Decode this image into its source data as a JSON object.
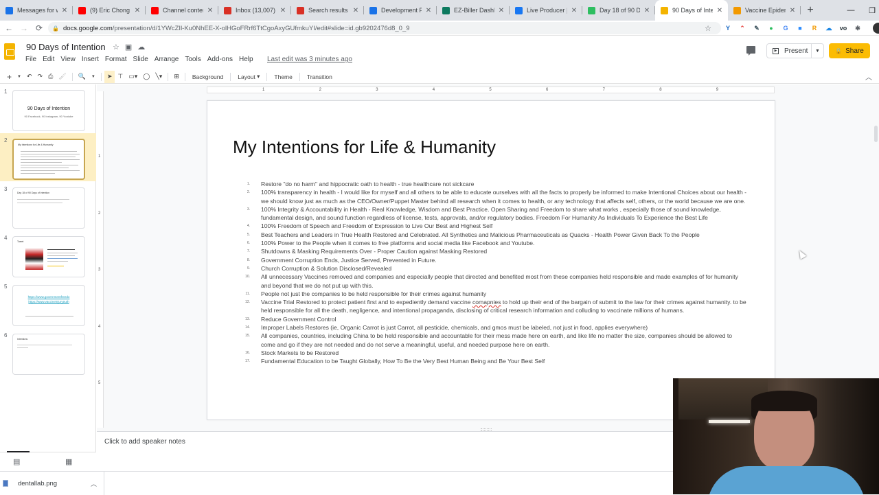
{
  "browser": {
    "tabs": [
      {
        "label": "Messages for w",
        "icon": "messenger-icon",
        "color": "#1a73e8",
        "active": false
      },
      {
        "label": "(9) Eric Chong -",
        "icon": "youtube-icon",
        "color": "#ff0000",
        "active": false
      },
      {
        "label": "Channel conten",
        "icon": "youtube-icon",
        "color": "#ff0000",
        "active": false
      },
      {
        "label": "Inbox (13,007) -",
        "icon": "gmail-icon",
        "color": "#d93025",
        "active": false
      },
      {
        "label": "Search results -",
        "icon": "gmail-icon",
        "color": "#d93025",
        "active": false
      },
      {
        "label": "Development P",
        "icon": "app-icon",
        "color": "#1a73e8",
        "active": false
      },
      {
        "label": "EZ-Biller Dashbo",
        "icon": "ez-icon",
        "color": "#0d7a5f",
        "active": false
      },
      {
        "label": "Live Producer |",
        "icon": "facebook-icon",
        "color": "#1877f2",
        "active": false
      },
      {
        "label": "Day 18 of 90 Da",
        "icon": "evernote-icon",
        "color": "#2dbe60",
        "active": false
      },
      {
        "label": "90 Days of Inter",
        "icon": "slides-icon",
        "color": "#f4b400",
        "active": true
      },
      {
        "label": "Vaccine Epidem",
        "icon": "document-icon",
        "color": "#f29900",
        "active": false
      }
    ],
    "new_tab": "+",
    "window_controls": {
      "minimize": "—",
      "maximize": "❐"
    },
    "url_host": "docs.google.com",
    "url_path": "/presentation/d/1YWcZIl-Ku0NhEE-X-olHGoFRrf6TtCgoAxyGUfmkuYI/edit#slide=id.gb9202476d8_0_9",
    "extensions": [
      {
        "name": "y-extension-icon",
        "glyph": "Y",
        "color": "#1565c0"
      },
      {
        "name": "chart-extension-icon",
        "glyph": "⌃",
        "color": "#e53935"
      },
      {
        "name": "eyedropper-icon",
        "glyph": "✎",
        "color": "#455a64"
      },
      {
        "name": "evernote-icon",
        "glyph": "●",
        "color": "#2dbe60"
      },
      {
        "name": "translate-icon",
        "glyph": "G",
        "color": "#4285f4"
      },
      {
        "name": "zoom-icon",
        "glyph": "■",
        "color": "#2d8cff"
      },
      {
        "name": "r-extension-icon",
        "glyph": "R",
        "color": "#f29900"
      },
      {
        "name": "cloud-icon",
        "glyph": "☁",
        "color": "#1e88e5"
      },
      {
        "name": "vo-extension-icon",
        "glyph": "vo",
        "color": "#263238"
      },
      {
        "name": "puzzle-icon",
        "glyph": "✱",
        "color": "#5f6368"
      }
    ]
  },
  "doc": {
    "title": "90 Days of Intention",
    "menu": [
      "File",
      "Edit",
      "View",
      "Insert",
      "Format",
      "Slide",
      "Arrange",
      "Tools",
      "Add-ons",
      "Help"
    ],
    "last_edit": "Last edit was 3 minutes ago",
    "present_label": "Present",
    "share_label": "Share",
    "toolbar": {
      "background": "Background",
      "layout": "Layout",
      "theme": "Theme",
      "transition": "Transition"
    }
  },
  "filmstrip": {
    "slides": [
      {
        "num": "1",
        "title": "90 Days of Intention",
        "subtitle": "90 Facebook, 90 Instagram, 90 Youtube"
      },
      {
        "num": "2",
        "title": "My Intentions for Life & Humanity",
        "selected": true
      },
      {
        "num": "3",
        "title": "Day 18 of 90 Days of Intention"
      },
      {
        "num": "4",
        "title": "Tweet"
      },
      {
        "num": "5",
        "links": [
          "https://www.governmentfreedo",
          "https://www.vaccineinjurytruth"
        ]
      },
      {
        "num": "6",
        "title": "Intentions"
      }
    ]
  },
  "ruler": {
    "h_ticks": [
      "1",
      "2",
      "3",
      "4",
      "5",
      "6",
      "7",
      "8",
      "9"
    ],
    "v_ticks": [
      "1",
      "2",
      "3",
      "4",
      "5"
    ]
  },
  "slide": {
    "title": "My Intentions for Life & Humanity",
    "items": [
      {
        "num": "1.",
        "text": "Restore \"do no harm\" and hippocratic oath to health - true healthcare not sickcare"
      },
      {
        "num": "2.",
        "text": "100% transparency in health - I would like for myself and all others to be able to educate ourselves with all the facts to properly be informed to make Intentional Choices about our health - we should know just as much as the CEO/Owner/Puppet Master behind all research when it comes to health, or any technology that affects self, others, or the world because we are one."
      },
      {
        "num": "3.",
        "text": "100% Integrity & Accountability in Health - Real Knowledge, Wisdom and Best Practice. Open Sharing and Freedom to share what works , especially those of sound knowledge, fundamental design, and sound function regardless of license, tests, approvals, and/or regulatory bodies. Freedom For Humanity As Individuals To Experience the Best Life"
      },
      {
        "num": "4.",
        "text": "100% Freedom of Speech and Freedom of Expression to Live Our Best and Highest Self"
      },
      {
        "num": "5.",
        "text": "Best Teachers and Leaders in True Health Restored and Celebrated. All Synthetics and Malicious Pharmaceuticals as Quacks - Health Power Given Back To the People"
      },
      {
        "num": "6.",
        "text": "100% Power to the People when it comes to free platforms and social media like Facebook and Youtube."
      },
      {
        "num": "7.",
        "text": "Shutdowns & Masking Requirements Over - Proper Caution against Masking Restored"
      },
      {
        "num": "8.",
        "text": "Government Corruption Ends, Justice Served, Prevented in Future."
      },
      {
        "num": "9.",
        "text": "Church Corruption & Solution Disclosed/Revealed"
      },
      {
        "num": "10.",
        "text": "All unnecessary Vaccines removed and companies and especially people that directed and benefited most from these companies held responsible and made examples of for humanity and beyond that we do not put up with this."
      },
      {
        "num": "11.",
        "text": "People not just the companies to be held responsible for their crimes against humanity"
      },
      {
        "num": "12.",
        "text_before": "Vaccine Trial  Restored to protect patient first and to expediently demand vaccine ",
        "misspelled": "comapnies",
        "text_after": " to hold up their end of the bargain of submit to the law for their crimes against humanity. to be held responsible for all the death, negligence, and intentional propaganda, disclosing of critical research information and colluding to vaccinate millions of humans."
      },
      {
        "num": "13.",
        "text": "Reduce Government Control"
      },
      {
        "num": "14.",
        "text": "Improper Labels Restores (ie, Organic Carrot is just Carrot, all pesticide, chemicals, and gmos must be labeled, not just in food, applies everywhere)"
      },
      {
        "num": "15.",
        "text": "All companies, countries, including China to be held responsible and accountable for their mess made here on earth, and like life no matter the size, companies should be allowed to come and go if they are not needed and do not serve a meaningful, useful, and needed purpose here on earth."
      },
      {
        "num": "16.",
        "text": "Stock Markets to be Restored"
      },
      {
        "num": "17.",
        "text": "Fundamental Education to be Taught Globally, How To Be the Very Best Human Being and Be Your Best Self"
      }
    ]
  },
  "notes": {
    "placeholder": "Click to add speaker notes"
  },
  "downloads": {
    "file": "dentallab.png"
  }
}
